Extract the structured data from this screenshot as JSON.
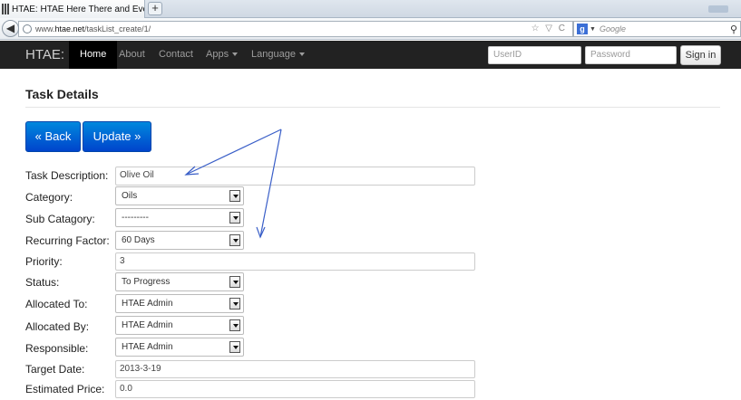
{
  "browser": {
    "tab_title": "HTAE: HTAE Here There and Everywhere...",
    "new_tab": "+",
    "url_prefix": "www.",
    "url_domain": "htae.net",
    "url_path": "/taskList_create/1/",
    "url_controls": "☆ ▽ C",
    "search_engine": "Google"
  },
  "nav": {
    "brand": "HTAE:",
    "items": [
      "Home",
      "About",
      "Contact",
      "Apps",
      "Language"
    ],
    "userid_placeholder": "UserID",
    "password_placeholder": "Password",
    "signin_label": "Sign in"
  },
  "page": {
    "title": "Task Details",
    "back_label": "« Back",
    "update_label": "Update »"
  },
  "form": {
    "task_description": {
      "label": "Task Description:",
      "value": "Olive Oil"
    },
    "category": {
      "label": "Category:",
      "value": "Oils"
    },
    "sub_category": {
      "label": "Sub Catagory:",
      "value": "---------"
    },
    "recurring_factor": {
      "label": "Recurring Factor:",
      "value": "60 Days"
    },
    "priority": {
      "label": "Priority:",
      "value": "3"
    },
    "status": {
      "label": "Status:",
      "value": "To Progress"
    },
    "allocated_to": {
      "label": "Allocated To:",
      "value": "HTAE Admin"
    },
    "allocated_by": {
      "label": "Allocated By:",
      "value": "HTAE Admin"
    },
    "responsible": {
      "label": "Responsible:",
      "value": "HTAE Admin"
    },
    "target_date": {
      "label": "Target Date:",
      "value": "2013-3-19"
    },
    "estimated_price": {
      "label": "Estimated Price:",
      "value": "0.0"
    }
  },
  "colors": {
    "navbar_bg": "#222222",
    "primary_button": "#0055cc",
    "annotation_arrow": "#3a5fc8"
  }
}
